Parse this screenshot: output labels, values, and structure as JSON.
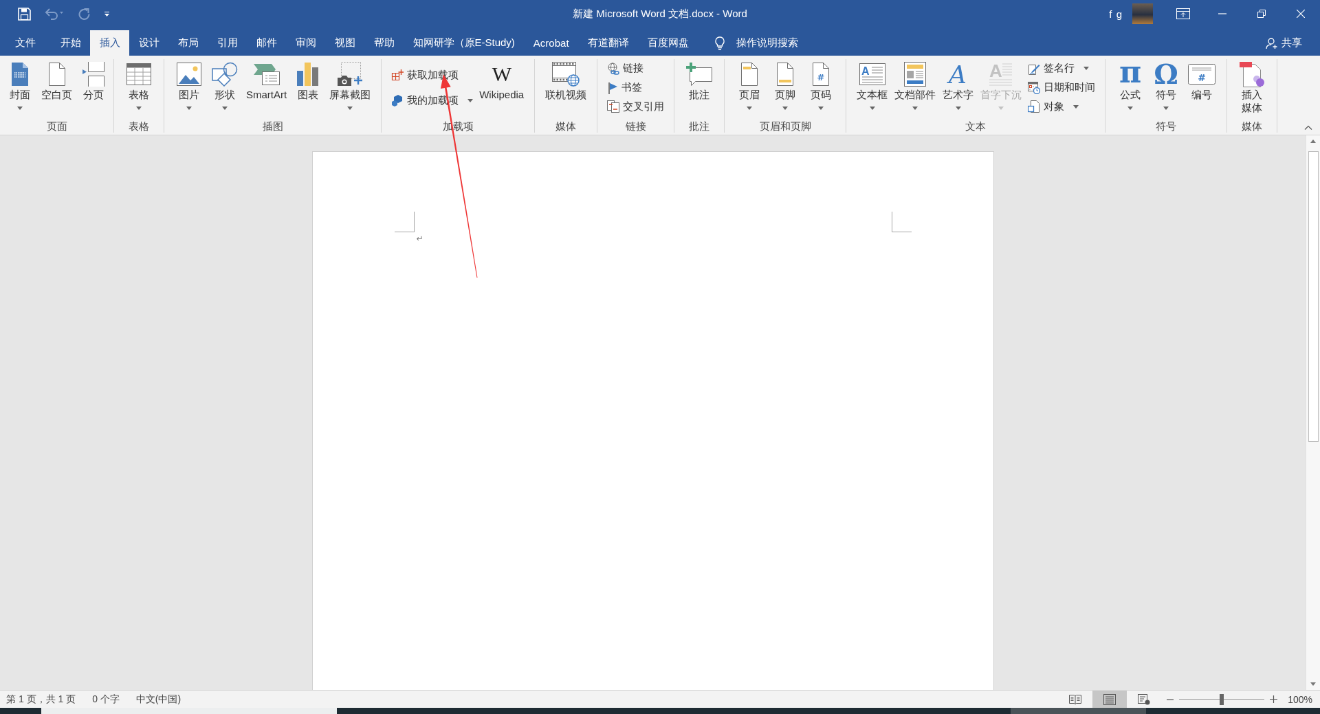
{
  "window": {
    "title": "新建 Microsoft Word 文档.docx - Word",
    "user": "f g"
  },
  "quick_access": [
    {
      "disabled": false
    },
    {
      "disabled": true
    },
    {
      "disabled": true
    },
    {
      "disabled": false
    }
  ],
  "tabs": [
    {
      "label": "文件",
      "selected": false
    },
    {
      "label": "开始",
      "selected": false
    },
    {
      "label": "插入",
      "selected": true
    },
    {
      "label": "设计",
      "selected": false
    },
    {
      "label": "布局",
      "selected": false
    },
    {
      "label": "引用",
      "selected": false
    },
    {
      "label": "邮件",
      "selected": false
    },
    {
      "label": "审阅",
      "selected": false
    },
    {
      "label": "视图",
      "selected": false
    },
    {
      "label": "帮助",
      "selected": false
    },
    {
      "label": "知网研学（原E-Study)",
      "selected": false
    },
    {
      "label": "Acrobat",
      "selected": false
    },
    {
      "label": "有道翻译",
      "selected": false
    },
    {
      "label": "百度网盘",
      "selected": false
    }
  ],
  "tell_me": {
    "label": "操作说明搜索"
  },
  "share": {
    "label": "共享"
  },
  "ribbon": {
    "groups": [
      {
        "label": "页面",
        "items": [
          {
            "kind": "large",
            "label": "封面",
            "dropdown": true,
            "disabled": false
          },
          {
            "kind": "large",
            "label": "空白页",
            "dropdown": false,
            "disabled": false
          },
          {
            "kind": "large",
            "label": "分页",
            "dropdown": false,
            "disabled": false
          }
        ]
      },
      {
        "label": "表格",
        "items": [
          {
            "kind": "large",
            "label": "表格",
            "dropdown": true,
            "disabled": false
          }
        ]
      },
      {
        "label": "插图",
        "items": [
          {
            "kind": "large",
            "label": "图片",
            "dropdown": true,
            "disabled": false
          },
          {
            "kind": "large",
            "label": "形状",
            "dropdown": true,
            "disabled": false
          },
          {
            "kind": "large",
            "label": "SmartArt",
            "dropdown": false,
            "disabled": false
          },
          {
            "kind": "large",
            "label": "图表",
            "dropdown": false,
            "disabled": false
          },
          {
            "kind": "large",
            "label": "屏幕截图",
            "dropdown": true,
            "disabled": false
          }
        ]
      },
      {
        "label": "加载项",
        "items": [
          {
            "kind": "small",
            "label": "获取加载项",
            "dropdown": false,
            "disabled": false
          },
          {
            "kind": "small",
            "label": "我的加载项",
            "dropdown": true,
            "disabled": false
          },
          {
            "kind": "large",
            "label": "Wikipedia",
            "glyph": "W",
            "dropdown": false,
            "disabled": false
          }
        ]
      },
      {
        "label": "媒体",
        "items": [
          {
            "kind": "large",
            "label": "联机视频",
            "dropdown": false,
            "disabled": false
          }
        ]
      },
      {
        "label": "链接",
        "items": [
          {
            "kind": "small",
            "label": "链接",
            "dropdown": false,
            "disabled": false
          },
          {
            "kind": "small",
            "label": "书签",
            "dropdown": false,
            "disabled": false
          },
          {
            "kind": "small",
            "label": "交叉引用",
            "dropdown": false,
            "disabled": false
          }
        ]
      },
      {
        "label": "批注",
        "items": [
          {
            "kind": "large",
            "label": "批注",
            "dropdown": false,
            "disabled": false
          }
        ]
      },
      {
        "label": "页眉和页脚",
        "items": [
          {
            "kind": "large",
            "label": "页眉",
            "dropdown": true,
            "disabled": false
          },
          {
            "kind": "large",
            "label": "页脚",
            "dropdown": true,
            "disabled": false
          },
          {
            "kind": "large",
            "label": "页码",
            "glyph": "#",
            "dropdown": true,
            "disabled": false
          }
        ]
      },
      {
        "label": "文本",
        "items": [
          {
            "kind": "large",
            "label": "文本框",
            "glyph": "A",
            "dropdown": true,
            "disabled": false
          },
          {
            "kind": "large",
            "label": "文档部件",
            "dropdown": true,
            "disabled": false
          },
          {
            "kind": "large",
            "label": "艺术字",
            "glyph": "A",
            "dropdown": true,
            "disabled": false
          },
          {
            "kind": "large",
            "label": "首字下沉",
            "glyph": "A",
            "dropdown": true,
            "disabled": true
          },
          {
            "kind": "small",
            "label": "签名行",
            "dropdown": true,
            "disabled": false
          },
          {
            "kind": "small",
            "label": "日期和时间",
            "dropdown": false,
            "disabled": false
          },
          {
            "kind": "small",
            "label": "对象",
            "dropdown": true,
            "disabled": false
          }
        ]
      },
      {
        "label": "符号",
        "items": [
          {
            "kind": "large",
            "label": "公式",
            "glyph": "π",
            "dropdown": true,
            "disabled": false
          },
          {
            "kind": "large",
            "label": "符号",
            "glyph": "Ω",
            "dropdown": true,
            "disabled": false
          },
          {
            "kind": "large",
            "label": "编号",
            "glyph": "#",
            "dropdown": false,
            "disabled": false
          }
        ]
      },
      {
        "label": "媒体",
        "items": [
          {
            "kind": "large",
            "label": "插入媒体",
            "dropdown": false,
            "disabled": false
          }
        ]
      }
    ]
  },
  "document": {
    "paragraph_mark": "↵"
  },
  "status_bar": {
    "items": [
      "第 1 页，共 1 页",
      "0 个字",
      "中文(中国)"
    ],
    "views": [
      {
        "selected": false
      },
      {
        "selected": true
      },
      {
        "selected": false
      }
    ],
    "zoom": {
      "level": 0.5,
      "reading": "100%"
    }
  }
}
